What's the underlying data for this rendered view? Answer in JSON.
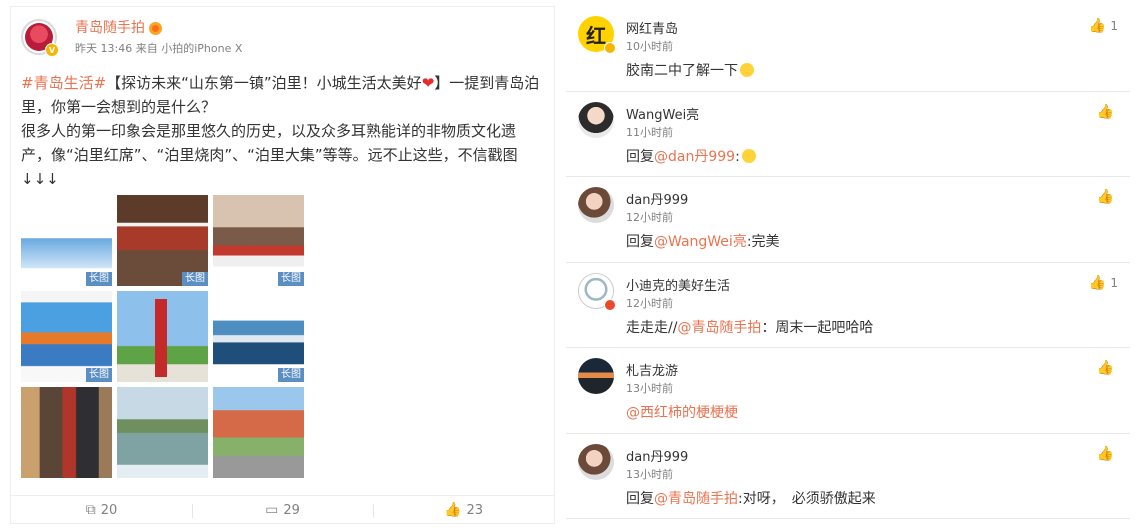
{
  "post": {
    "author": "青岛随手拍",
    "time": "昨天 13:46",
    "source_prefix": "来自",
    "source": "小拍的iPhone X",
    "hashtag": "#青岛生活#",
    "text_part1": "【探访未来“山东第一镇”泊里！小城生活太美好",
    "text_part2": "】一提到青岛泊里，你第一会想到的是什么？",
    "text_line2": "很多人的第一印象会是那里悠久的历史，以及众多耳熟能详的非物质文化遗产，像“泊里红席”、“泊里烧肉”、“泊里大集”等等。远不止这些，不信戳图↓↓↓",
    "long_image_tag": "长图",
    "actions": {
      "repost": "20",
      "comment": "29",
      "like": "23"
    }
  },
  "comments": [
    {
      "name": "网红青岛",
      "time": "10小时前",
      "text": "胶南二中了解一下",
      "likes": "1",
      "avatar_char": "红"
    },
    {
      "name": "WangWei亮",
      "time": "11小时前",
      "reply_prefix": "回复",
      "mention": "@dan丹999",
      "text": ":",
      "likes": ""
    },
    {
      "name": "dan丹999",
      "time": "12小时前",
      "reply_prefix": "回复",
      "mention": "@WangWei亮",
      "text": ":完美",
      "likes": ""
    },
    {
      "name": "小迪克的美好生活",
      "time": "12小时前",
      "prefix": "走走走//",
      "mention": "@青岛随手拍",
      "text": "：周末一起吧哈哈",
      "likes": "1"
    },
    {
      "name": "札吉龙游",
      "time": "13小时前",
      "mention": "@西红柿的梗梗梗",
      "likes": ""
    },
    {
      "name": "dan丹999",
      "time": "13小时前",
      "reply_prefix": "回复",
      "mention": "@青岛随手拍",
      "text": ":对呀，　必须骄傲起来",
      "likes": ""
    }
  ],
  "colors": {
    "accent": "#eb7350",
    "tag_blue": "#5b8ec2"
  }
}
